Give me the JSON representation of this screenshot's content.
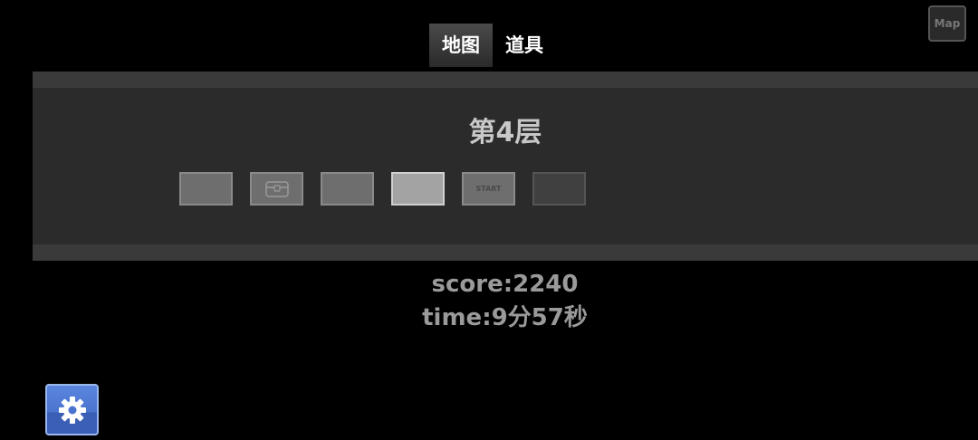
{
  "tabs": [
    {
      "label": "地图",
      "active": true
    },
    {
      "label": "道具",
      "active": false
    }
  ],
  "map_button_label": "Map",
  "floor": {
    "title": "第4层",
    "rooms": [
      {
        "type": "empty",
        "label": ""
      },
      {
        "type": "treasure",
        "icon": "treasure-chest-icon",
        "label": ""
      },
      {
        "type": "empty",
        "label": ""
      },
      {
        "type": "current",
        "label": ""
      },
      {
        "type": "start",
        "label": "START"
      },
      {
        "type": "unexplored",
        "label": ""
      }
    ]
  },
  "stats": {
    "score": "score:2240",
    "time": "time:9分57秒"
  },
  "settings": {
    "icon": "gear-icon"
  },
  "colors": {
    "background": "#000000",
    "panel": "#2b2b2b",
    "panel_border": "#3a3a3a",
    "room": "#6e6e6e",
    "room_current": "#a3a3a3",
    "settings_blue": "#4a74cf"
  }
}
